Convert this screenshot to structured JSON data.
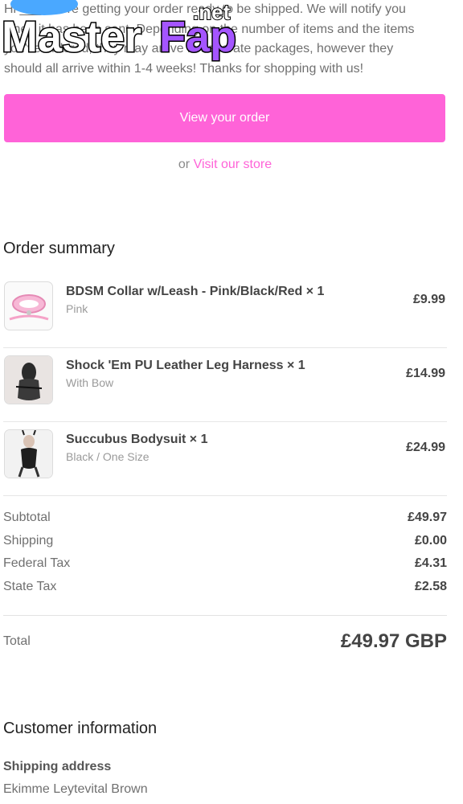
{
  "watermark": {
    "word": "MasterFap",
    "suffix": ".net"
  },
  "intro": {
    "line1": "Hi ___, we're getting your order ready to be shipped. We will notify you",
    "line2": "when it has been sent. Depending on the number of items and the items",
    "line3": "you've ordered, they may arrive in separate packages, however they",
    "line4": "should all arrive within 1-4 weeks! Thanks for shopping with us!"
  },
  "cta": {
    "view_order": "View your order",
    "or": "or",
    "visit_store": "Visit our store"
  },
  "order_summary": {
    "title": "Order summary",
    "items": [
      {
        "title": "BDSM Collar w/Leash - Pink/Black/Red × 1",
        "variant": "Pink",
        "price": "£9.99",
        "thumb": "pink-collar-image"
      },
      {
        "title": "Shock 'Em PU Leather Leg Harness × 1",
        "variant": "With Bow",
        "price": "£14.99",
        "thumb": "leg-harness-image"
      },
      {
        "title": "Succubus Bodysuit × 1",
        "variant": "Black / One Size",
        "price": "£24.99",
        "thumb": "bodysuit-image"
      }
    ],
    "totals": [
      {
        "label": "Subtotal",
        "value": "£49.97"
      },
      {
        "label": "Shipping",
        "value": "£0.00"
      },
      {
        "label": "Federal Tax",
        "value": "£4.31"
      },
      {
        "label": "State Tax",
        "value": "£2.58"
      }
    ],
    "total_label": "Total",
    "total_value": "£49.97 GBP"
  },
  "customer_info": {
    "title": "Customer information",
    "shipping_label": "Shipping address",
    "shipping_name": "Ekimme Leytevital Brown"
  },
  "colors": {
    "accent": "#ff63d8"
  }
}
